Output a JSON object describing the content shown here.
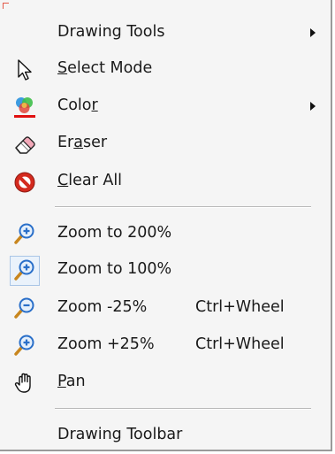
{
  "menu": {
    "items": [
      {
        "label": "Drawing Tools",
        "mnemonic": "",
        "has_submenu": true
      },
      {
        "pre": "",
        "mn": "S",
        "post": "elect Mode",
        "icon": "cursor-arrow-icon"
      },
      {
        "pre": "Colo",
        "mn": "r",
        "post": "",
        "icon": "color-palette-icon",
        "has_submenu": true
      },
      {
        "pre": "Er",
        "mn": "a",
        "post": "ser",
        "icon": "eraser-icon"
      },
      {
        "pre": "",
        "mn": "C",
        "post": "lear All",
        "icon": "clear-all-icon"
      },
      {
        "label": "Zoom to 200%",
        "icon": "zoom-in-icon"
      },
      {
        "label": "Zoom to 100%",
        "icon": "zoom-in-icon",
        "checked": true
      },
      {
        "label": "Zoom -25%",
        "shortcut": "Ctrl+Wheel",
        "icon": "zoom-out-icon"
      },
      {
        "label": "Zoom +25%",
        "shortcut": "Ctrl+Wheel",
        "icon": "zoom-in-icon"
      },
      {
        "pre": "",
        "mn": "P",
        "post": "an",
        "icon": "pan-hand-icon"
      },
      {
        "label": "Drawing Toolbar"
      }
    ]
  },
  "colors": {
    "menu_bg": "#f5f5f5",
    "separator": "#b9b9b9",
    "color_underline": "#e01010",
    "clear_red": "#d42a1e",
    "zoom_blue": "#2a6fc9"
  }
}
